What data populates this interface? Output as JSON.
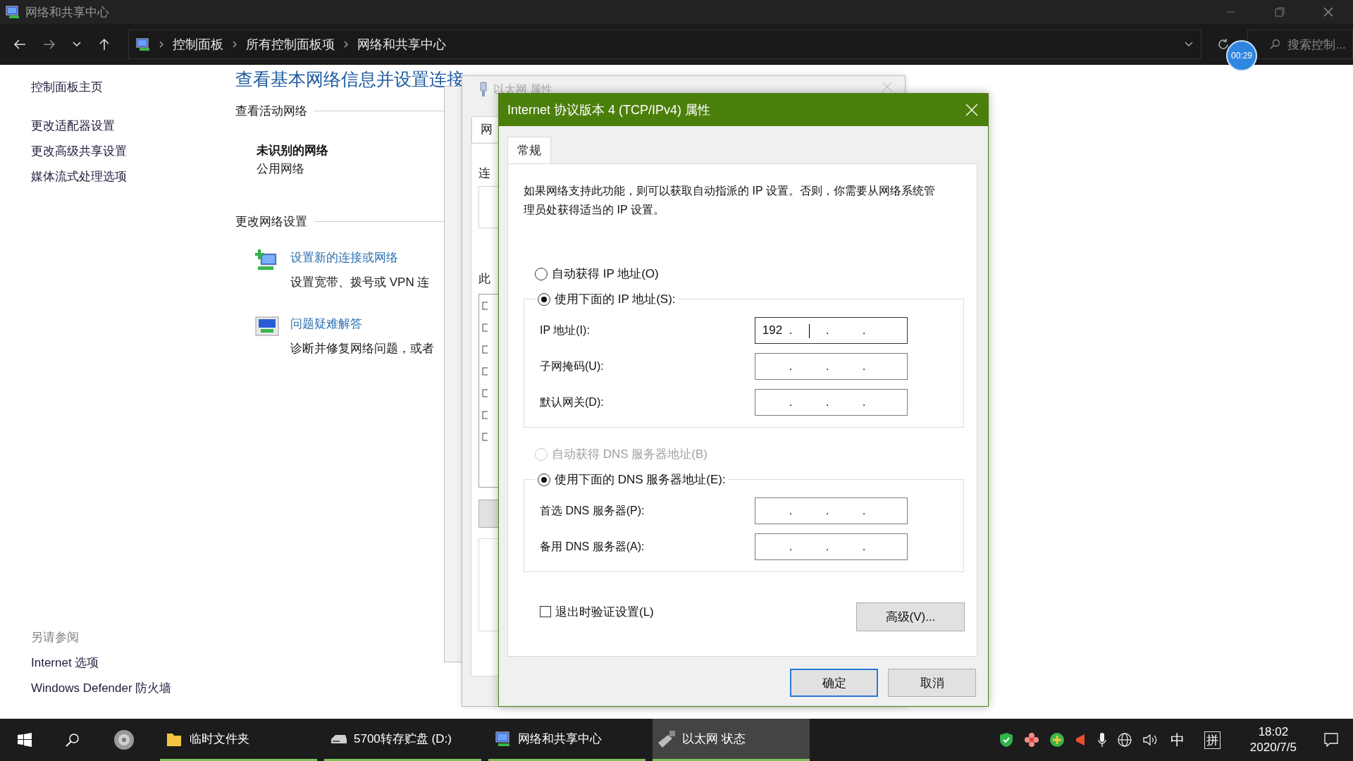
{
  "window": {
    "title": "网络和共享中心"
  },
  "address_bar": {
    "crumbs": [
      "控制面板",
      "所有控制面板项",
      "网络和共享中心"
    ],
    "search": {
      "placeholder": "搜索控制..."
    }
  },
  "timer_badge": "00:29",
  "sidebar": {
    "items": [
      "控制面板主页",
      "更改适配器设置",
      "更改高级共享设置",
      "媒体流式处理选项"
    ],
    "see_also": {
      "title": "另请参阅",
      "items": [
        "Internet 选项",
        "Windows Defender 防火墙"
      ]
    }
  },
  "main": {
    "heading": "查看基本网络信息并设置连接",
    "active_networks": {
      "title": "查看活动网络",
      "network_name": "未识别的网络",
      "network_type": "公用网络"
    },
    "change_settings": {
      "title": "更改网络设置",
      "tasks": [
        {
          "kind": "new-connection",
          "link": "设置新的连接或网络",
          "description": "设置宽带、拨号或 VPN 连"
        },
        {
          "kind": "troubleshoot",
          "link": "问题疑难解答",
          "description": "诊断并修复网络问题，或者"
        }
      ]
    }
  },
  "back_window": {
    "title": "以太网 属性",
    "tab": "网",
    "labels": [
      "连",
      "此"
    ]
  },
  "dialog": {
    "title": "Internet 协议版本 4 (TCP/IPv4) 属性",
    "tabs": [
      {
        "label": "常规",
        "selected": true
      }
    ],
    "description": "如果网络支持此功能，则可以获取自动指派的 IP 设置。否则，你需要从网络系统管理员处获得适当的 IP 设置。",
    "octet_separator": ".",
    "sections": [
      {
        "options": [
          {
            "label": "自动获得 IP 地址(O)",
            "selected": false,
            "disabled": false
          },
          {
            "label": "使用下面的 IP 地址(S):",
            "selected": true,
            "disabled": false
          }
        ],
        "fields": [
          {
            "label": "IP 地址(I):",
            "octets": [
              "192"
            ],
            "focused": true
          },
          {
            "label": "子网掩码(U):",
            "focused": false
          },
          {
            "label": "默认网关(D):",
            "focused": false
          }
        ]
      },
      {
        "options": [
          {
            "label": "自动获得 DNS 服务器地址(B)",
            "selected": false,
            "disabled": true
          },
          {
            "label": "使用下面的 DNS 服务器地址(E):",
            "selected": true,
            "disabled": false
          }
        ],
        "fields": [
          {
            "label": "首选 DNS 服务器(P):",
            "focused": false
          },
          {
            "label": "备用 DNS 服务器(A):",
            "focused": false
          }
        ]
      }
    ],
    "validate_checkbox": {
      "label": "退出时验证设置(L)",
      "checked": false
    },
    "advanced_button": "高级(V)...",
    "buttons": [
      {
        "label": "确定",
        "default": true
      },
      {
        "label": "取消",
        "default": false
      }
    ]
  },
  "taskbar": {
    "apps": [
      {
        "kind": "folder",
        "label": "临时文件夹",
        "selected": false
      },
      {
        "kind": "drive",
        "label": "5700转存贮盘 (D:)",
        "selected": false
      },
      {
        "kind": "network",
        "label": "网络和共享中心",
        "selected": false
      },
      {
        "kind": "ethernet",
        "label": "以太网 状态",
        "selected": true
      }
    ],
    "ime": "中",
    "ime_mode": "拼",
    "time": "18:02",
    "date": "2020/7/5"
  }
}
